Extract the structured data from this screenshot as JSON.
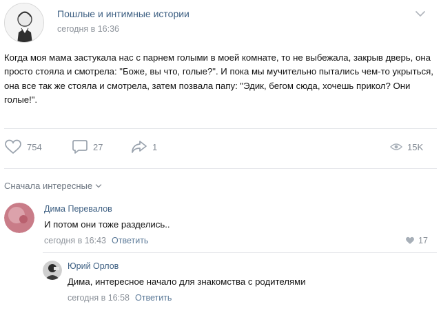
{
  "post": {
    "group_name": "Пошлые и интимные истории",
    "time": "сегодня в 16:36",
    "text": "Когда моя мама застукала нас с парнем голыми в моей комнате, то не выбежала, закрыв дверь, она просто стояла и смотрела: \"Боже, вы что, голые?\". И пока мы мучительно пытались чем-то укрыться, она все так же стояла и смотрела, затем позвала папу: \"Эдик, бегом сюда, хочешь прикол? Они голые!\".",
    "likes": "754",
    "comments": "27",
    "shares": "1",
    "views": "15K"
  },
  "sort_label": "Сначала интересные",
  "comments": [
    {
      "author": "Дима Перевалов",
      "text": "И потом они тоже разделись..",
      "time": "сегодня в 16:43",
      "reply_label": "Ответить",
      "likes": "17"
    },
    {
      "author": "Юрий Орлов",
      "text": "Дима, интересное начало для знакомства с родителями",
      "time": "сегодня в 16:58",
      "reply_label": "Ответить"
    }
  ],
  "icons": {
    "chevron": "chevron-down-icon",
    "like": "heart-icon",
    "comment": "comment-icon",
    "share": "share-icon",
    "views": "eye-icon"
  },
  "colors": {
    "link": "#3d5f82",
    "muted": "#8c929a",
    "icon": "#828a94"
  }
}
